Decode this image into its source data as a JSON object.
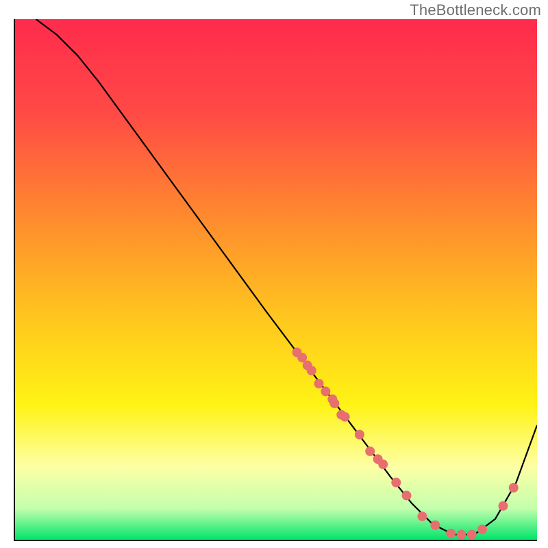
{
  "watermark": "TheBottleneck.com",
  "colors": {
    "curve": "#000000",
    "marker_fill": "#e76f6f",
    "marker_stroke": "#e76f6f"
  },
  "chart_data": {
    "type": "line",
    "title": "",
    "xlabel": "",
    "ylabel": "",
    "xlim": [
      0,
      100
    ],
    "ylim": [
      0,
      100
    ],
    "series": [
      {
        "name": "curve",
        "x": [
          4,
          8,
          12,
          16,
          24,
          32,
          40,
          48,
          54,
          60,
          66,
          72,
          76,
          80,
          84,
          88,
          92,
          96,
          100
        ],
        "y": [
          100,
          97,
          93,
          88,
          77,
          66,
          55,
          44,
          36,
          28,
          20,
          12,
          7,
          3,
          1,
          1,
          4,
          11,
          22
        ]
      }
    ],
    "markers": {
      "name": "highlight-dots",
      "x": [
        54,
        55,
        56,
        56.8,
        58.2,
        59.5,
        60.8,
        61.2,
        62.5,
        63.2,
        66,
        68,
        69.5,
        70.5,
        73,
        75,
        78,
        80.5,
        83.5,
        85.5,
        87.5,
        89.5,
        93.5,
        95.5
      ],
      "y": [
        36,
        35,
        33.5,
        32.5,
        30,
        28.5,
        27,
        26.2,
        24,
        23.6,
        20.2,
        17,
        15.5,
        14.5,
        11,
        8.5,
        4.5,
        2.8,
        1.2,
        1,
        1,
        2,
        6.5,
        10
      ]
    }
  }
}
